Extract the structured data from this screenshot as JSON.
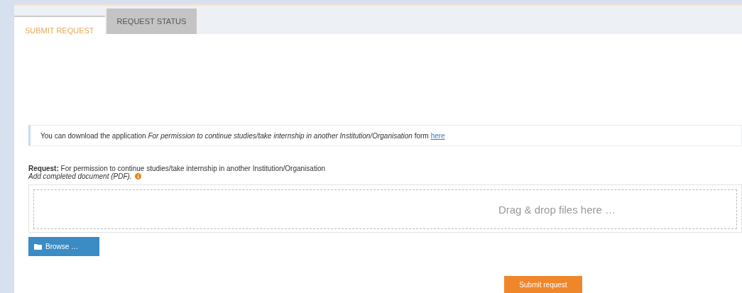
{
  "tabs": [
    {
      "label": "SUBMIT REQUEST",
      "selected": true
    },
    {
      "label": "REQUEST STATUS",
      "selected": false
    }
  ],
  "notice": {
    "text": "You can download the application *For permission to continue studies/take internship in another Institution/Organisation* form",
    "link": "here"
  },
  "request": {
    "label": "**Request:** For permission to continue studies/take internship in another Institution/Organisation",
    "hint": "Add completed document (PDF)."
  },
  "dropzone": {
    "placeholder": "Drag & drop files here …"
  },
  "browse_button": "Browse …",
  "submit_button": "Submit request"
}
